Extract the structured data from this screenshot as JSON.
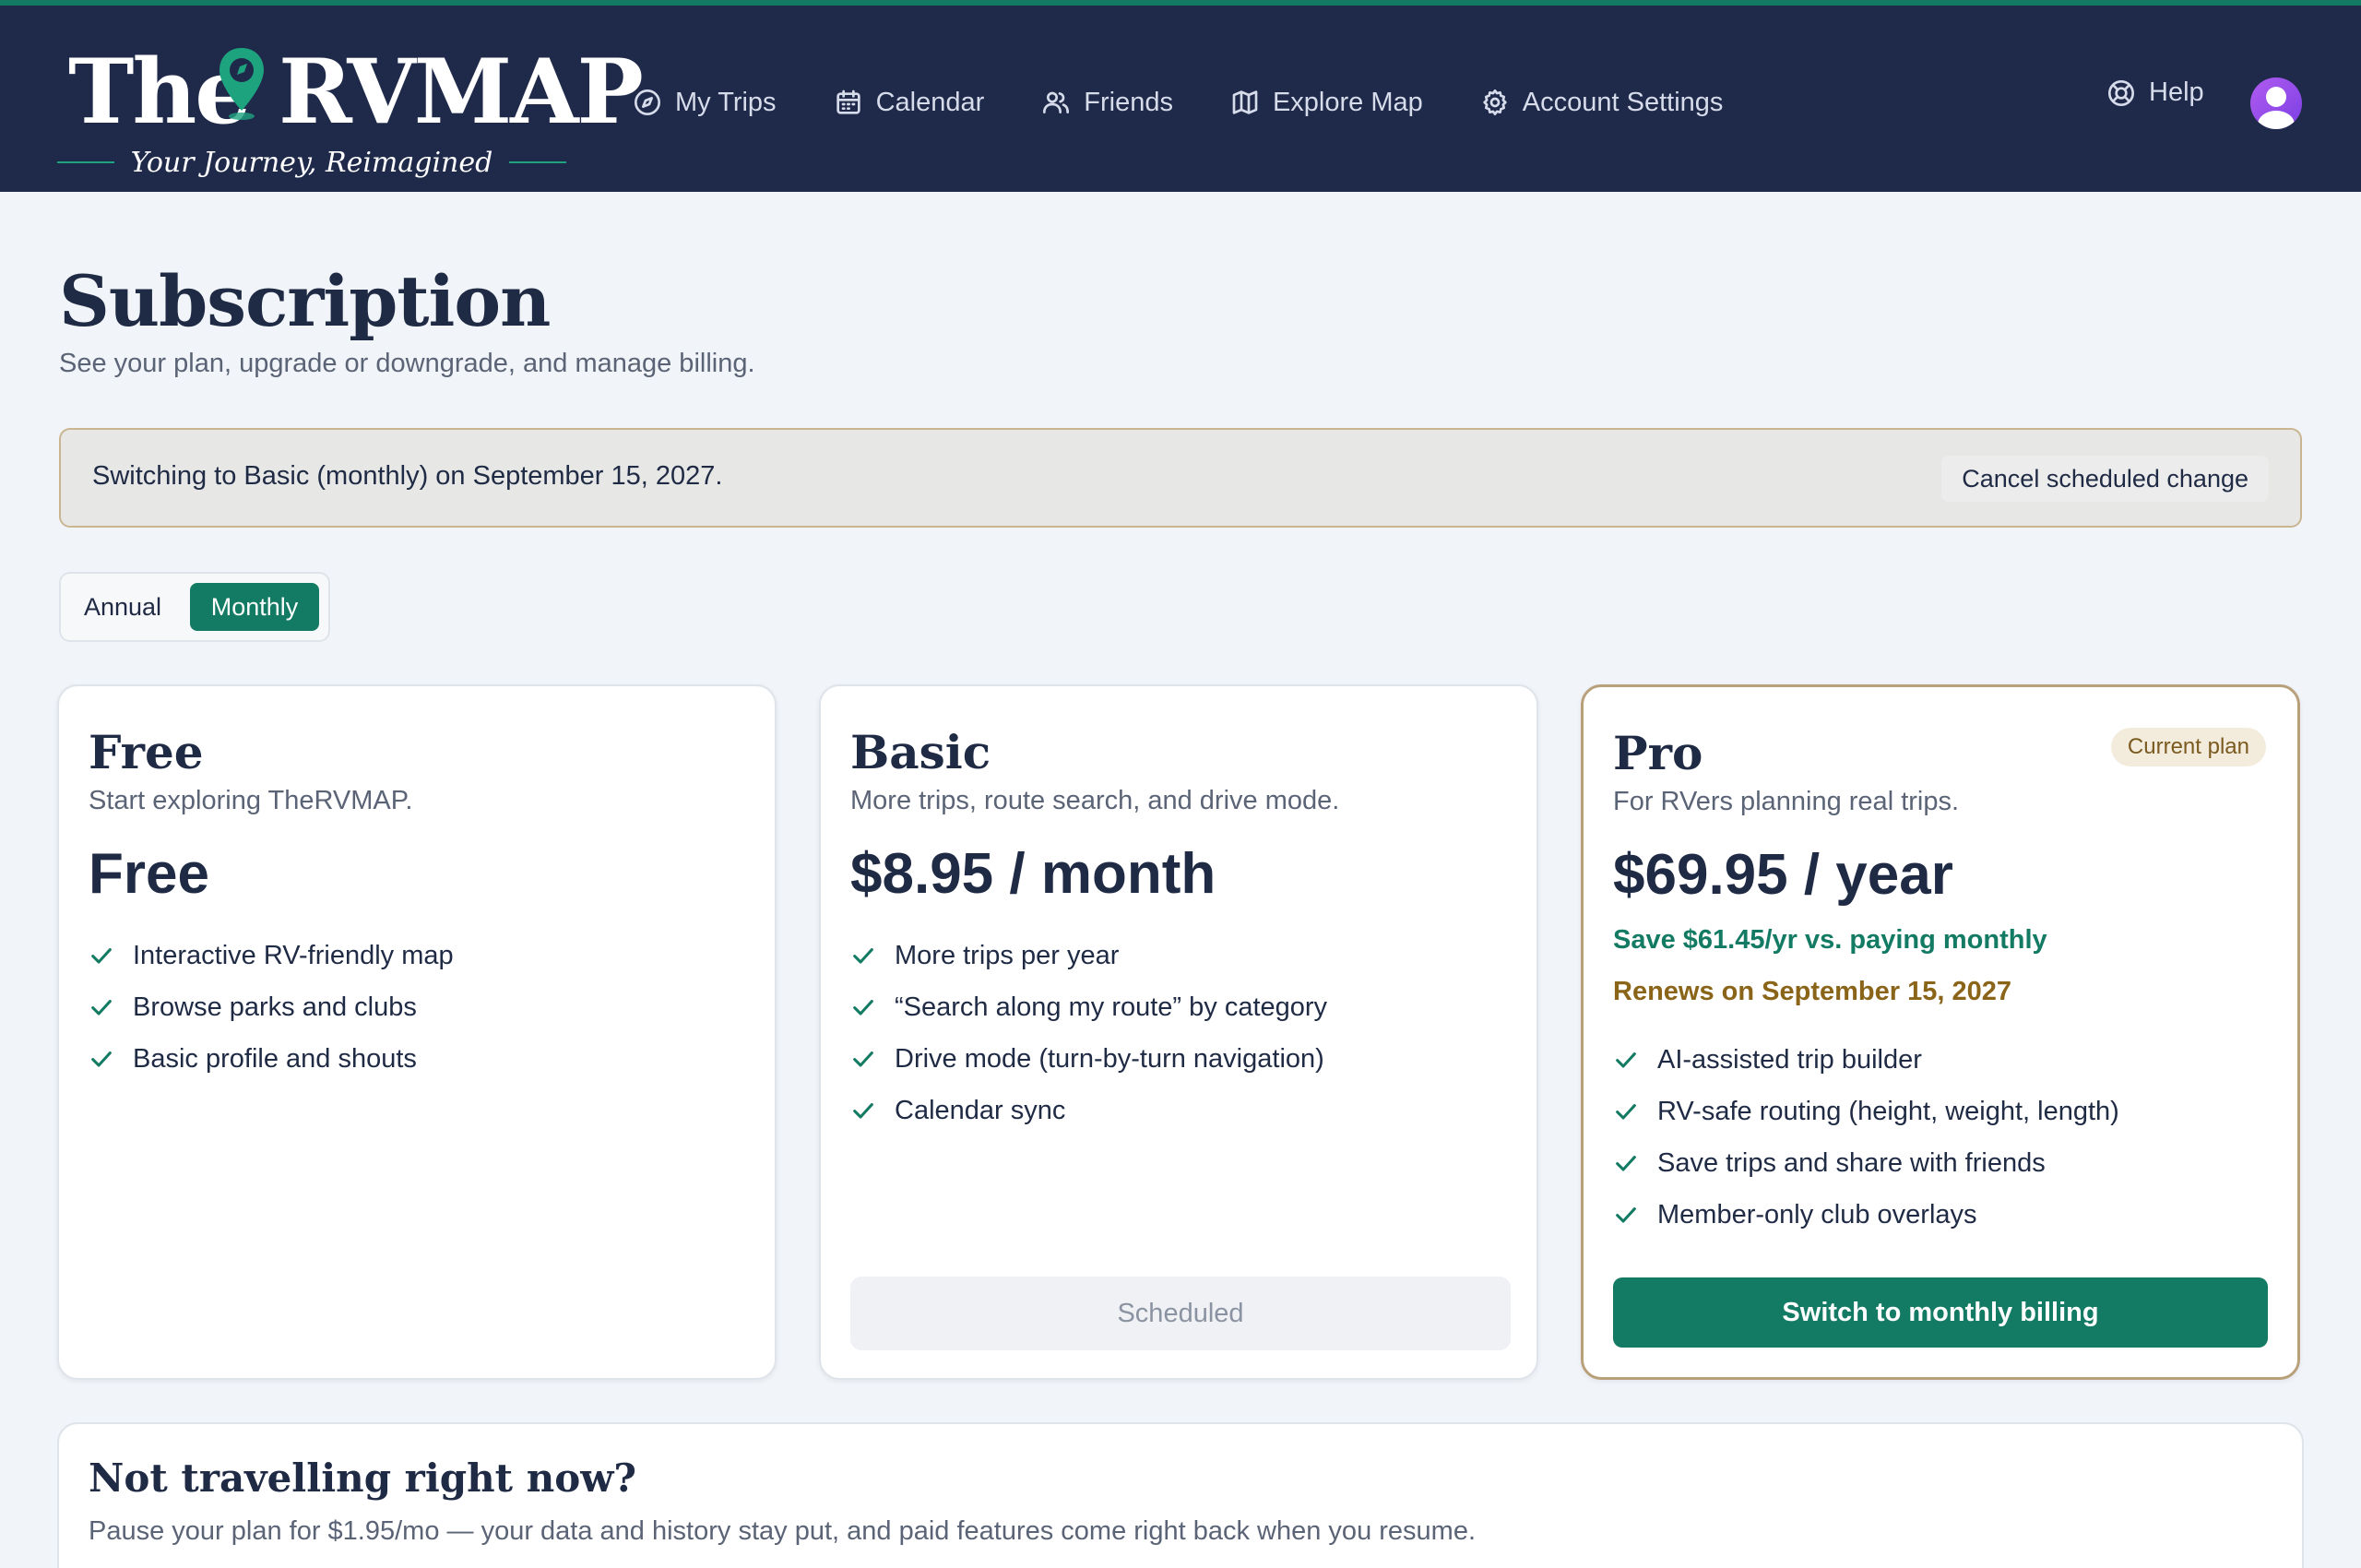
{
  "brand": {
    "word_the": "The",
    "word_rvmap": "RVMAP",
    "tagline": "Your Journey, Reimagined",
    "accent_color": "#137a63",
    "header_color": "#1f2a4a"
  },
  "nav": {
    "items": [
      {
        "label": "My Trips",
        "icon": "compass-icon"
      },
      {
        "label": "Calendar",
        "icon": "calendar-icon"
      },
      {
        "label": "Friends",
        "icon": "users-icon"
      },
      {
        "label": "Explore Map",
        "icon": "map-icon"
      },
      {
        "label": "Account Settings",
        "icon": "gear-icon"
      }
    ],
    "help_label": "Help",
    "help_icon": "lifebuoy-icon",
    "avatar_icon": "user-avatar-icon"
  },
  "page": {
    "title": "Subscription",
    "subtitle": "See your plan, upgrade or downgrade, and manage billing."
  },
  "banner": {
    "text": "Switching to Basic (monthly) on September 15, 2027.",
    "button_label": "Cancel scheduled change"
  },
  "billing_toggle": {
    "options": [
      "Annual",
      "Monthly"
    ],
    "selected": "Monthly"
  },
  "plans": [
    {
      "name": "Free",
      "description": "Start exploring TheRVMAP.",
      "price": "Free",
      "features": [
        "Interactive RV-friendly map",
        "Browse parks and clubs",
        "Basic profile and shouts"
      ]
    },
    {
      "name": "Basic",
      "description": "More trips, route search, and drive mode.",
      "price": "$8.95 / month",
      "features": [
        "More trips per year",
        "“Search along my route” by category",
        "Drive mode (turn-by-turn navigation)",
        "Calendar sync"
      ],
      "button_label": "Scheduled"
    },
    {
      "name": "Pro",
      "badge": "Current plan",
      "description": "For RVers planning real trips.",
      "price": "$69.95 / year",
      "savings": "Save $61.45/yr vs. paying monthly",
      "renewal": "Renews on September 15, 2027",
      "features": [
        "AI-assisted trip builder",
        "RV-safe routing (height, weight, length)",
        "Save trips and share with friends",
        "Member-only club overlays"
      ],
      "button_label": "Switch to monthly billing"
    }
  ],
  "pause": {
    "title": "Not travelling right now?",
    "text": "Pause your plan for $1.95/mo — your data and history stay put, and paid features come right back when you resume."
  }
}
